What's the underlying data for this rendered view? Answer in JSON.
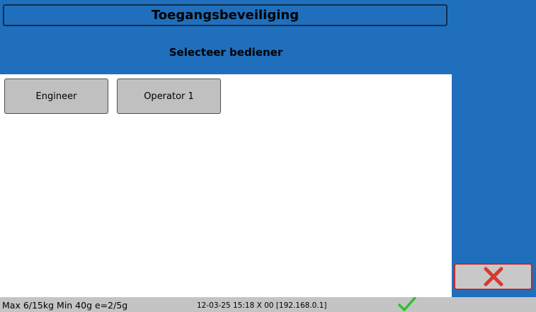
{
  "header": {
    "title": "Toegangsbeveiliging",
    "subtitle": "Selecteer bediener"
  },
  "users": [
    {
      "label": "Engineer"
    },
    {
      "label": "Operator 1"
    }
  ],
  "actions": {
    "cancel_icon": "close-icon",
    "cancel_color": "#d9382f"
  },
  "status_bar": {
    "scale_info": "Max 6/15kg Min 40g e=2/5g",
    "datetime_address": "12-03-25 15:18 X 00 [192.168.0.1]",
    "status_icon": "checkmark-icon",
    "status_color": "#2fbf2f"
  },
  "colors": {
    "panel_blue": "#1f6fbd",
    "content_bg": "#ffffff",
    "button_gray": "#c0c0c0"
  }
}
